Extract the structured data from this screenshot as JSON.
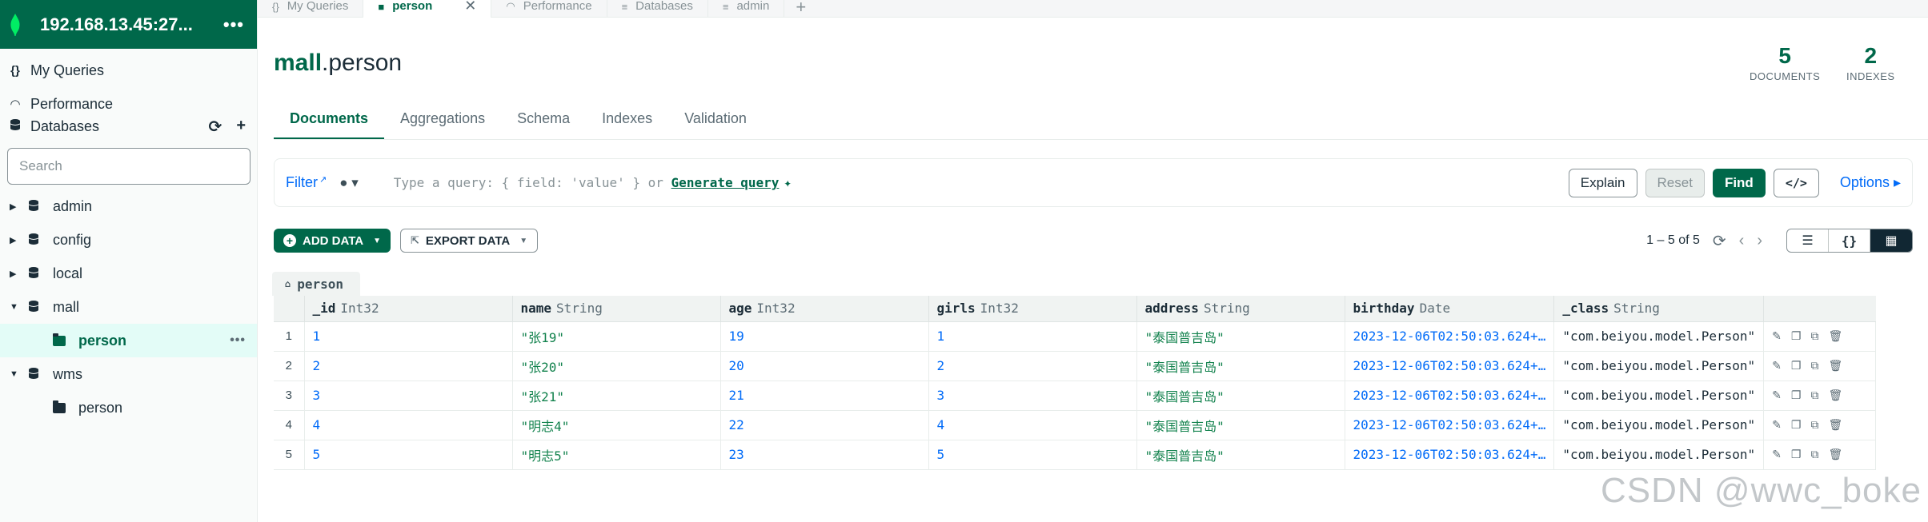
{
  "sidebar": {
    "connection_title": "192.168.13.45:27...",
    "connection_more": "•••",
    "nav": [
      {
        "icon": "{}",
        "label": "My Queries"
      },
      {
        "icon": "◠",
        "label": "Performance"
      },
      {
        "icon": "≡",
        "label": "Databases"
      }
    ],
    "db_actions": {
      "refresh": "⟳",
      "add": "+"
    },
    "search_placeholder": "Search",
    "tree": [
      {
        "name": "admin"
      },
      {
        "name": "config"
      },
      {
        "name": "local"
      },
      {
        "name": "mall"
      },
      {
        "name": "person",
        "collection_of": "mall"
      },
      {
        "name": "wms"
      },
      {
        "name": "person",
        "collection_of": "wms"
      }
    ]
  },
  "tabs": [
    {
      "icon": "{}",
      "label": "My Queries"
    },
    {
      "icon": "■",
      "label": "person",
      "active": true
    },
    {
      "icon": "◠",
      "label": "Performance"
    },
    {
      "icon": "≡",
      "label": "Databases"
    },
    {
      "icon": "≡",
      "label": "admin"
    }
  ],
  "namespace": {
    "db": "mall",
    "separator": ".",
    "collection": "person"
  },
  "stats": {
    "documents": {
      "value": "5",
      "label": "DOCUMENTS"
    },
    "indexes": {
      "value": "2",
      "label": "INDEXES"
    }
  },
  "subtabs": [
    "Documents",
    "Aggregations",
    "Schema",
    "Indexes",
    "Validation"
  ],
  "query": {
    "filter_label": "Filter",
    "placeholder": "Type a query: { field: 'value' } or",
    "generate": "Generate query",
    "explain": "Explain",
    "reset": "Reset",
    "find": "Find",
    "code": "</>",
    "options": "Options ▸"
  },
  "toolbar": {
    "add_data": "ADD DATA",
    "export_data": "EXPORT DATA",
    "pager": "1 – 5 of 5"
  },
  "grid": {
    "label": "person",
    "columns": [
      {
        "name": "_id",
        "type": "Int32"
      },
      {
        "name": "name",
        "type": "String"
      },
      {
        "name": "age",
        "type": "Int32"
      },
      {
        "name": "girls",
        "type": "Int32"
      },
      {
        "name": "address",
        "type": "String"
      },
      {
        "name": "birthday",
        "type": "Date"
      },
      {
        "name": "_class",
        "type": "String"
      }
    ],
    "rows": [
      {
        "n": "1",
        "id": "1",
        "name": "\"张19\"",
        "age": "19",
        "girls": "1",
        "address": "\"泰国普吉岛\"",
        "birthday": "2023-12-06T02:50:03.624+…",
        "cls": "\"com.beiyou.model.Person\""
      },
      {
        "n": "2",
        "id": "2",
        "name": "\"张20\"",
        "age": "20",
        "girls": "2",
        "address": "\"泰国普吉岛\"",
        "birthday": "2023-12-06T02:50:03.624+…",
        "cls": "\"com.beiyou.model.Person\""
      },
      {
        "n": "3",
        "id": "3",
        "name": "\"张21\"",
        "age": "21",
        "girls": "3",
        "address": "\"泰国普吉岛\"",
        "birthday": "2023-12-06T02:50:03.624+…",
        "cls": "\"com.beiyou.model.Person\""
      },
      {
        "n": "4",
        "id": "4",
        "name": "\"明志4\"",
        "age": "22",
        "girls": "4",
        "address": "\"泰国普吉岛\"",
        "birthday": "2023-12-06T02:50:03.624+…",
        "cls": "\"com.beiyou.model.Person\""
      },
      {
        "n": "5",
        "id": "5",
        "name": "\"明志5\"",
        "age": "23",
        "girls": "5",
        "address": "\"泰国普吉岛\"",
        "birthday": "2023-12-06T02:50:03.624+…",
        "cls": "\"com.beiyou.model.Person\""
      }
    ]
  },
  "watermark": "CSDN @wwc_boke",
  "colors": {
    "brand": "#00684a",
    "link": "#016bf8",
    "string": "#12824d"
  }
}
